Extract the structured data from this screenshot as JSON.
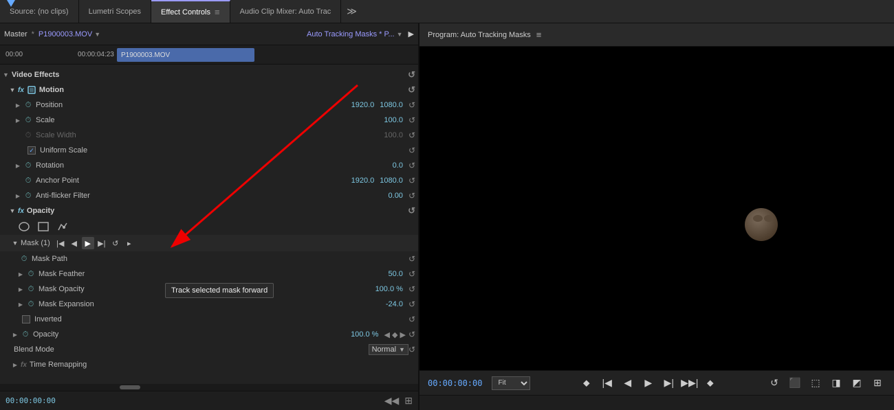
{
  "tabs": {
    "source": "Source: (no clips)",
    "lumetri": "Lumetri Scopes",
    "effect_controls": "Effect Controls",
    "audio_clip": "Audio Clip Mixer: Auto Trac",
    "more_icon": "≫"
  },
  "subheader": {
    "master_label": "Master",
    "file_name": "P1900003.MOV",
    "dropdown_arrow": "▼",
    "tracking_label": "Auto Tracking Masks * P...",
    "play_icon": "▶"
  },
  "timeline": {
    "time_start": "00:00",
    "time_mid": "00:00:04:23",
    "clip_label": "P1900003.MOV"
  },
  "effects": {
    "section_label": "Video Effects",
    "motion": {
      "label": "Motion",
      "props": {
        "position": {
          "name": "Position",
          "val1": "1920.0",
          "val2": "1080.0"
        },
        "scale": {
          "name": "Scale",
          "val1": "100.0"
        },
        "scale_width": {
          "name": "Scale Width",
          "val1": "100.0",
          "disabled": true
        },
        "uniform_scale": {
          "name": "Uniform Scale",
          "checked": true
        },
        "rotation": {
          "name": "Rotation",
          "val1": "0.0"
        },
        "anchor_point": {
          "name": "Anchor Point",
          "val1": "1920.0",
          "val2": "1080.0"
        },
        "anti_flicker": {
          "name": "Anti-flicker Filter",
          "val1": "0.00"
        }
      }
    },
    "opacity": {
      "label": "Opacity",
      "mask1": {
        "label": "Mask (1)",
        "mask_path": {
          "name": "Mask Path"
        },
        "mask_feather": {
          "name": "Mask Feather",
          "val1": "50.0"
        },
        "mask_opacity": {
          "name": "Mask Opacity",
          "val1": "100.0 %"
        },
        "mask_expansion": {
          "name": "Mask Expansion",
          "val1": "-24.0"
        },
        "inverted": {
          "name": "Inverted"
        }
      },
      "opacity_prop": {
        "name": "Opacity",
        "val1": "100.0 %"
      },
      "blend_mode": {
        "name": "Blend Mode",
        "val1": "Normal"
      }
    },
    "time_remapping": {
      "label": "Time Remapping"
    }
  },
  "tooltip": {
    "text": "Track selected mask forward"
  },
  "program": {
    "title": "Program: Auto Tracking Masks",
    "menu_icon": "≡",
    "timecode": "00:00:00:00",
    "fit_label": "Fit",
    "fit_dropdown": "▼"
  },
  "controls": {
    "mark_in": "⬥",
    "step_back_many": "|◀",
    "step_back": "◀",
    "play": "▶",
    "step_fwd": "▶|",
    "mark_out": "⬥",
    "loop": "↻",
    "extract": "⬚",
    "lift": "⬛",
    "insert": "◨",
    "overwrite": "◩",
    "export": "⊞"
  },
  "bottom": {
    "timecode": "00:00:00:00",
    "scroll_icon": "⋯",
    "export_icon": "⊞"
  },
  "mask_buttons": {
    "to_start": "|◀",
    "prev": "◀",
    "track_forward": "▶",
    "to_end": "▶|",
    "reset": "↺",
    "next_arr": "▶"
  }
}
